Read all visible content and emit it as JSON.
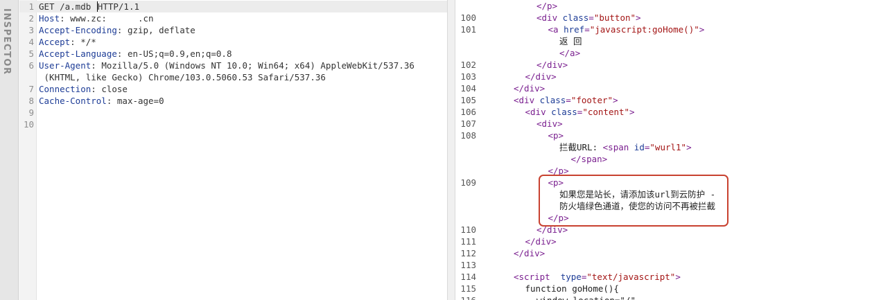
{
  "sidebar": {
    "inspector_label": "INSPECTOR"
  },
  "request": {
    "lines": [
      {
        "n": "1",
        "name": "",
        "value": "GET /a.mdb HTTP/1.1",
        "current": true
      },
      {
        "n": "2",
        "name": "Host",
        "value": "www.zc:      .cn"
      },
      {
        "n": "3",
        "name": "Accept-Encoding",
        "value": "gzip, deflate"
      },
      {
        "n": "4",
        "name": "Accept",
        "value": "*/*"
      },
      {
        "n": "5",
        "name": "Accept-Language",
        "value": "en-US;q=0.9,en;q=0.8"
      },
      {
        "n": "6",
        "name": "User-Agent",
        "value": "Mozilla/5.0 (Windows NT 10.0; Win64; x64) AppleWebKit/537.36"
      },
      {
        "n": "",
        "name": "",
        "value": " (KHTML, like Gecko) Chrome/103.0.5060.53 Safari/537.36"
      },
      {
        "n": "7",
        "name": "Connection",
        "value": "close"
      },
      {
        "n": "8",
        "name": "Cache-Control",
        "value": "max-age=0"
      },
      {
        "n": "9",
        "name": "",
        "value": ""
      },
      {
        "n": "10",
        "name": "",
        "value": ""
      }
    ]
  },
  "response": {
    "lines": [
      {
        "n": "",
        "indent": 6,
        "parts": [
          [
            "tag",
            "</p>"
          ]
        ]
      },
      {
        "n": "100",
        "indent": 6,
        "parts": [
          [
            "tag",
            "<div "
          ],
          [
            "attr",
            "class"
          ],
          [
            "tag",
            "="
          ],
          [
            "val",
            "\"button\""
          ],
          [
            "tag",
            ">"
          ]
        ]
      },
      {
        "n": "101",
        "indent": 7,
        "parts": [
          [
            "tag",
            "<a "
          ],
          [
            "attr",
            "href"
          ],
          [
            "tag",
            "="
          ],
          [
            "val",
            "\"javascript:goHome()\""
          ],
          [
            "tag",
            ">"
          ]
        ]
      },
      {
        "n": "",
        "indent": 8,
        "parts": [
          [
            "txt",
            "返 回"
          ]
        ]
      },
      {
        "n": "",
        "indent": 8,
        "parts": [
          [
            "tag",
            "</a>"
          ]
        ]
      },
      {
        "n": "102",
        "indent": 6,
        "parts": [
          [
            "tag",
            "</div>"
          ]
        ]
      },
      {
        "n": "103",
        "indent": 5,
        "parts": [
          [
            "tag",
            "</div>"
          ]
        ]
      },
      {
        "n": "104",
        "indent": 4,
        "parts": [
          [
            "tag",
            "</div>"
          ]
        ]
      },
      {
        "n": "105",
        "indent": 4,
        "parts": [
          [
            "tag",
            "<div "
          ],
          [
            "attr",
            "class"
          ],
          [
            "tag",
            "="
          ],
          [
            "val",
            "\"footer\""
          ],
          [
            "tag",
            ">"
          ]
        ]
      },
      {
        "n": "106",
        "indent": 5,
        "parts": [
          [
            "tag",
            "<div "
          ],
          [
            "attr",
            "class"
          ],
          [
            "tag",
            "="
          ],
          [
            "val",
            "\"content\""
          ],
          [
            "tag",
            ">"
          ]
        ]
      },
      {
        "n": "107",
        "indent": 6,
        "parts": [
          [
            "tag",
            "<div>"
          ]
        ]
      },
      {
        "n": "108",
        "indent": 7,
        "parts": [
          [
            "tag",
            "<p>"
          ]
        ]
      },
      {
        "n": "",
        "indent": 8,
        "parts": [
          [
            "txt",
            "拦截URL: "
          ],
          [
            "tag",
            "<span "
          ],
          [
            "attr",
            "id"
          ],
          [
            "tag",
            "="
          ],
          [
            "val",
            "\"wurl1\""
          ],
          [
            "tag",
            ">"
          ]
        ]
      },
      {
        "n": "",
        "indent": 9,
        "parts": [
          [
            "tag",
            "</span>"
          ]
        ]
      },
      {
        "n": "",
        "indent": 7,
        "parts": [
          [
            "tag",
            "</p>"
          ]
        ]
      },
      {
        "n": "109",
        "indent": 7,
        "parts": [
          [
            "tag",
            "<p>"
          ]
        ]
      },
      {
        "n": "",
        "indent": 8,
        "parts": [
          [
            "txt",
            "如果您是站长，请添加该url到云防护 -"
          ]
        ]
      },
      {
        "n": "",
        "indent": 8,
        "parts": [
          [
            "txt",
            "防火墙绿色通道，使您的访问不再被拦截"
          ]
        ]
      },
      {
        "n": "",
        "indent": 7,
        "parts": [
          [
            "tag",
            "</p>"
          ]
        ]
      },
      {
        "n": "110",
        "indent": 6,
        "parts": [
          [
            "tag",
            "</div>"
          ]
        ]
      },
      {
        "n": "111",
        "indent": 5,
        "parts": [
          [
            "tag",
            "</div>"
          ]
        ]
      },
      {
        "n": "112",
        "indent": 4,
        "parts": [
          [
            "tag",
            "</div>"
          ]
        ]
      },
      {
        "n": "113",
        "indent": 4,
        "parts": []
      },
      {
        "n": "114",
        "indent": 4,
        "parts": [
          [
            "tag",
            "<script  "
          ],
          [
            "attr",
            "type"
          ],
          [
            "tag",
            "="
          ],
          [
            "val",
            "\"text/javascript\""
          ],
          [
            "tag",
            ">"
          ]
        ]
      },
      {
        "n": "115",
        "indent": 5,
        "parts": [
          [
            "txt",
            "function goHome(){"
          ]
        ]
      },
      {
        "n": "116",
        "indent": 6,
        "parts": [
          [
            "txt",
            "window.location=\"/\""
          ]
        ]
      }
    ]
  },
  "colors": {
    "highlight": "#c8412f",
    "tag": "#7a1f8f",
    "attr": "#1d3c96",
    "value": "#a31515"
  }
}
